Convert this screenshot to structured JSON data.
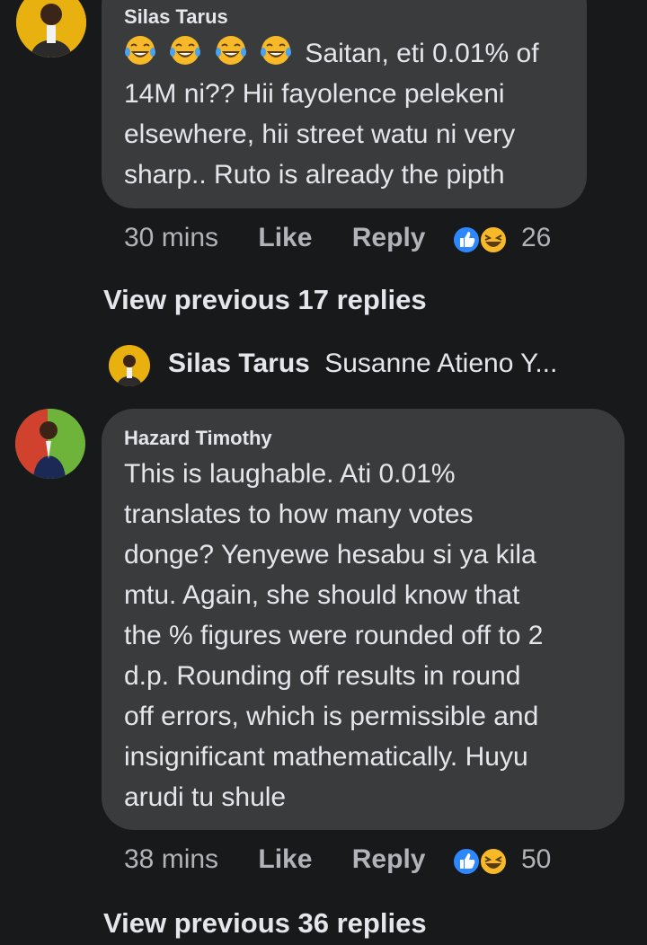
{
  "comments": [
    {
      "author": "Silas Tarus",
      "emoji_icons": [
        "laughing-crying-emoji",
        "laughing-crying-emoji",
        "laughing-crying-emoji",
        "laughing-crying-emoji"
      ],
      "lines": [
        "Saitan, eti 0.01% of",
        "14M ni?? Hii fayolence pelekeni",
        "elsewhere, hii street watu ni very",
        "sharp.. Ruto is already the pipth"
      ],
      "time": "30 mins",
      "like": "Like",
      "reply": "Reply",
      "reaction_count": "26"
    },
    {
      "author": "Hazard Timothy",
      "lines": [
        "This is laughable. Ati 0.01%",
        "translates to how many votes",
        "donge? Yenyewe hesabu si ya kila",
        "mtu. Again, she should know that",
        "the % figures were rounded off to 2",
        "d.p. Rounding off results in round",
        "off errors, which is permissible and",
        "insignificant mathematically. Huyu",
        "arudi tu shule"
      ],
      "time": "38 mins",
      "like": "Like",
      "reply": "Reply",
      "reaction_count": "50"
    }
  ],
  "view_previous_1": "View previous 17 replies",
  "reply_preview": {
    "author": "Silas Tarus",
    "text": "Susanne Atieno Y..."
  },
  "view_previous_2": "View previous 36 replies",
  "colors": {
    "background": "#18191a",
    "bubble": "#3a3b3c",
    "like_blue": "#2d88ff",
    "haha_yellow": "#f7b928"
  }
}
